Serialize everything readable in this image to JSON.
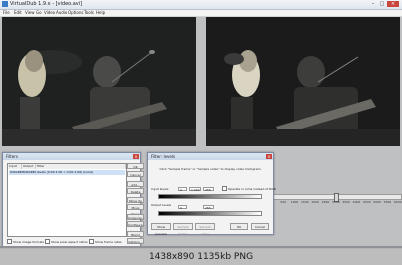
{
  "window": {
    "title": "VirtualDub 1.9.x - [video.avi]",
    "controls": {
      "minimize": "–",
      "maximize": "□",
      "close": "×"
    }
  },
  "menu": [
    "File",
    "Edit",
    "View",
    "Go",
    "Video",
    "Audio",
    "Options",
    "Tools",
    "Help"
  ],
  "timeline": {
    "ticks": [
      "0",
      "500",
      "1000",
      "1500",
      "2000",
      "2500",
      "3000",
      "3500",
      "4000",
      "4500",
      "5000",
      "5500",
      "6000"
    ],
    "position": 0.5
  },
  "filters_dialog": {
    "title": "Filters",
    "columns": [
      "Input",
      "Output",
      "Filter"
    ],
    "rows": [
      {
        "input": "640x480",
        "output": "640x480",
        "filter": "levels (0.00-1.00 > 0.00-1.00) (luma)"
      }
    ],
    "buttons": [
      "OK",
      "Cancel",
      "Add...",
      "Delete",
      "Move Up",
      "Move Down",
      "Cropping...",
      "Configure...",
      "Blend",
      "Options..."
    ],
    "checkboxes": [
      "Show image formats",
      "Show pixel aspect ratios",
      "Show frame rates"
    ]
  },
  "levels_dialog": {
    "title": "Filter: levels",
    "hint": "Click \"Sample frame\" or \"Sample video\" to display video histogram.",
    "input_label": "Input levels",
    "input_values": [
      "0",
      "1.000",
      "255"
    ],
    "output_label": "Output levels",
    "output_values": [
      "0",
      "255"
    ],
    "luma_option": "Operate in luma instead of RGB",
    "buttons": [
      "Show preview",
      "Sample frame",
      "Sample video",
      "OK",
      "Cancel"
    ]
  },
  "caption": "1438x890  1135kb  PNG",
  "colors": {
    "desktop": "#bfc0c2",
    "accent": "#3c7bc5",
    "close": "#c9463d"
  }
}
